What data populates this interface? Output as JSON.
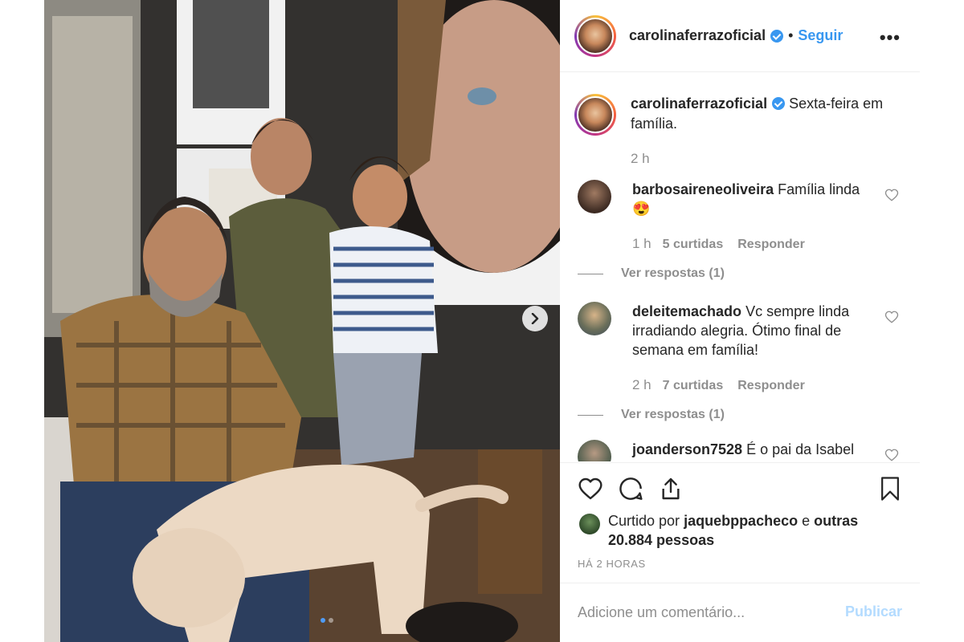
{
  "post": {
    "username": "carolinaferrazoficial",
    "follow_label": "Seguir",
    "separator": "•",
    "more_label": "•••",
    "caption": "Sexta-feira em família.",
    "caption_time": "2 h"
  },
  "comments": [
    {
      "user": "barbosaireneoliveira",
      "text": "Família linda 😍",
      "time": "1 h",
      "likes": "5 curtidas",
      "reply": "Responder",
      "view_replies": "Ver respostas (1)"
    },
    {
      "user": "deleitemachado",
      "text": "Vc sempre linda irradiando alegria. Ótimo final de semana em família!",
      "time": "2 h",
      "likes": "7 curtidas",
      "reply": "Responder",
      "view_replies": "Ver respostas (1)"
    },
    {
      "user": "joanderson7528",
      "text": "É o pai da Isabel"
    }
  ],
  "likes": {
    "prefix": "Curtido por",
    "user": "jaquebppacheco",
    "connector": "e",
    "others": "outras 20.884 pessoas"
  },
  "posted_when": "HÁ 2 HORAS",
  "add_comment": {
    "placeholder": "Adicione um comentário...",
    "publish_label": "Publicar"
  },
  "colors": {
    "link_blue": "#3897f0",
    "muted_text": "#8e8e8e",
    "publish_disabled": "#b3dbff"
  }
}
